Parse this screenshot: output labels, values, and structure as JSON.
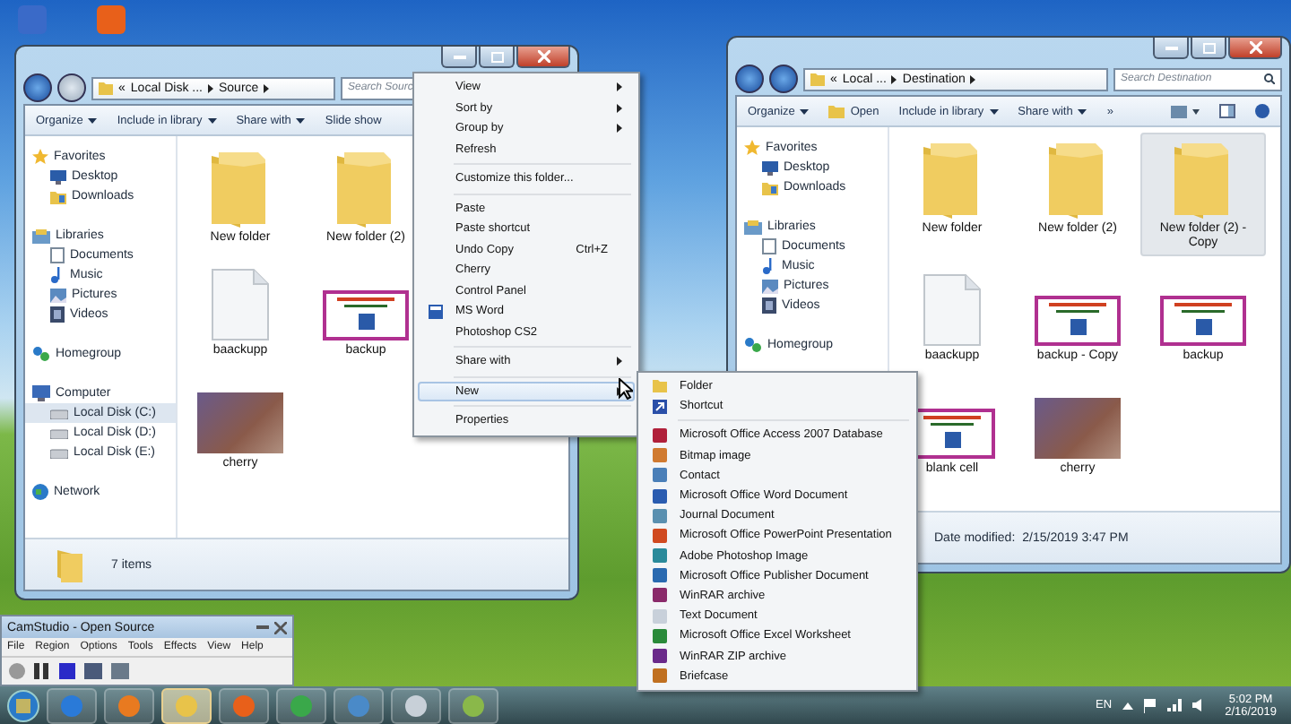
{
  "windows": [
    {
      "address": {
        "overflow": "«",
        "crumbs": [
          "Local Disk ...",
          "Source"
        ]
      },
      "search_placeholder": "Search Sourc",
      "toolbar": [
        {
          "label": "Organize",
          "menu": true
        },
        {
          "label": "Include in library",
          "menu": true
        },
        {
          "label": "Share with",
          "menu": true
        },
        {
          "label": "Slide show",
          "menu": false
        }
      ],
      "nav": [
        {
          "label": "Favorites",
          "kind": "star",
          "selected": false,
          "children": [
            {
              "label": "Desktop",
              "kind": "monitor",
              "selected": false
            },
            {
              "label": "Downloads",
              "kind": "folder",
              "selected": false
            }
          ]
        },
        {
          "label": "Libraries",
          "kind": "library",
          "selected": false,
          "children": [
            {
              "label": "Documents",
              "kind": "document",
              "selected": false
            },
            {
              "label": "Music",
              "kind": "note",
              "selected": false
            },
            {
              "label": "Pictures",
              "kind": "picture",
              "selected": false
            },
            {
              "label": "Videos",
              "kind": "film",
              "selected": false
            }
          ]
        },
        {
          "label": "Homegroup",
          "kind": "people",
          "selected": false
        },
        {
          "label": "Computer",
          "kind": "computer",
          "selected": false,
          "children": [
            {
              "label": "Local Disk (C:)",
              "kind": "drive",
              "selected": true
            },
            {
              "label": "Local Disk (D:)",
              "kind": "drive",
              "selected": false
            },
            {
              "label": "Local Disk (E:)",
              "kind": "drive",
              "selected": false
            }
          ]
        },
        {
          "label": "Network",
          "kind": "globe",
          "selected": false
        }
      ],
      "files": [
        {
          "name": "New folder",
          "kind": "folder",
          "selected": false
        },
        {
          "name": "New folder (2)",
          "kind": "folder",
          "selected": false
        },
        {
          "name": "baackupp",
          "kind": "blank",
          "selected": false
        },
        {
          "name": "backup",
          "kind": "slide",
          "selected": false
        },
        {
          "name": "cherry",
          "kind": "photo",
          "selected": false
        }
      ],
      "status": {
        "kind": "count",
        "text": "7 items"
      }
    },
    {
      "address": {
        "overflow": "«",
        "crumbs": [
          "Local ...",
          "Destination"
        ]
      },
      "search_placeholder": "Search Destination",
      "toolbar_icons": true,
      "toolbar": [
        {
          "label": "Organize",
          "menu": true
        },
        {
          "label": "Open",
          "menu": false,
          "icon": true
        },
        {
          "label": "Include in library",
          "menu": true
        },
        {
          "label": "Share with",
          "menu": true
        },
        {
          "label": "»",
          "menu": false
        }
      ],
      "nav": [
        {
          "label": "Favorites",
          "kind": "star",
          "selected": false,
          "children": [
            {
              "label": "Desktop",
              "kind": "monitor",
              "selected": false
            },
            {
              "label": "Downloads",
              "kind": "folder",
              "selected": false
            }
          ]
        },
        {
          "label": "Libraries",
          "kind": "library",
          "selected": false,
          "children": [
            {
              "label": "Documents",
              "kind": "document",
              "selected": false
            },
            {
              "label": "Music",
              "kind": "note",
              "selected": false
            },
            {
              "label": "Pictures",
              "kind": "picture",
              "selected": false
            },
            {
              "label": "Videos",
              "kind": "film",
              "selected": false
            }
          ]
        },
        {
          "label": "Homegroup",
          "kind": "people",
          "selected": false
        }
      ],
      "files": [
        {
          "name": "New folder",
          "kind": "folder",
          "selected": false
        },
        {
          "name": "New folder (2)",
          "kind": "folder",
          "selected": false
        },
        {
          "name": "New folder (2) - Copy",
          "kind": "folder",
          "selected": true
        },
        {
          "name": "baackupp",
          "kind": "blank",
          "selected": false
        },
        {
          "name": "backup - Copy",
          "kind": "slide",
          "selected": false
        },
        {
          "name": "backup",
          "kind": "slide",
          "selected": false
        },
        {
          "name": "blank cell",
          "kind": "slide",
          "selected": false
        },
        {
          "name": "cherry",
          "kind": "photo",
          "selected": false
        }
      ],
      "status": {
        "kind": "details",
        "label": "Date modified:",
        "text": "2/15/2019 3:47 PM"
      }
    }
  ],
  "context_menu": [
    {
      "kind": "item",
      "label": "View",
      "arrow": true,
      "selected": false
    },
    {
      "kind": "item",
      "label": "Sort by",
      "arrow": true,
      "selected": false
    },
    {
      "kind": "item",
      "label": "Group by",
      "arrow": true,
      "selected": false
    },
    {
      "kind": "item",
      "label": "Refresh",
      "arrow": false,
      "selected": false
    },
    {
      "kind": "separator"
    },
    {
      "kind": "item",
      "label": "Customize this folder...",
      "arrow": false,
      "selected": false
    },
    {
      "kind": "separator"
    },
    {
      "kind": "item",
      "label": "Paste",
      "arrow": false,
      "selected": false
    },
    {
      "kind": "item",
      "label": "Paste shortcut",
      "arrow": false,
      "selected": false
    },
    {
      "kind": "item",
      "label": "Undo Copy",
      "shortcut": "Ctrl+Z",
      "arrow": false,
      "selected": false
    },
    {
      "kind": "item",
      "label": "Cherry",
      "arrow": false,
      "selected": false
    },
    {
      "kind": "item",
      "label": "Control Panel",
      "arrow": false,
      "selected": false
    },
    {
      "kind": "app",
      "label": "MS Word",
      "arrow": false,
      "selected": false
    },
    {
      "kind": "item",
      "label": "Photoshop CS2",
      "arrow": false,
      "selected": false
    },
    {
      "kind": "separator"
    },
    {
      "kind": "item",
      "label": "Share with",
      "arrow": true,
      "selected": false
    },
    {
      "kind": "separator"
    },
    {
      "kind": "item",
      "label": "New",
      "arrow": true,
      "selected": true
    },
    {
      "kind": "separator"
    },
    {
      "kind": "item",
      "label": "Properties",
      "arrow": false,
      "selected": false
    }
  ],
  "new_submenu": [
    {
      "kind": "folder",
      "label": "Folder",
      "color": "#e8c34a",
      "selected": false
    },
    {
      "kind": "shortcut",
      "label": "Shortcut",
      "color": "#2a4fa8",
      "selected": false
    },
    {
      "kind": "separator"
    },
    {
      "kind": "file",
      "label": "Microsoft Office Access 2007 Database",
      "color": "#b0203a",
      "selected": false
    },
    {
      "kind": "file",
      "label": "Bitmap image",
      "color": "#d07a30",
      "selected": false
    },
    {
      "kind": "file",
      "label": "Contact",
      "color": "#4a7fb8",
      "selected": false
    },
    {
      "kind": "file",
      "label": "Microsoft Office Word Document",
      "color": "#2a5cb0",
      "selected": false
    },
    {
      "kind": "file",
      "label": "Journal Document",
      "color": "#5a90b0",
      "selected": false
    },
    {
      "kind": "file",
      "label": "Microsoft Office PowerPoint Presentation",
      "color": "#d04a20",
      "selected": false
    },
    {
      "kind": "file",
      "label": "Adobe Photoshop Image",
      "color": "#2a8a9a",
      "selected": false
    },
    {
      "kind": "file",
      "label": "Microsoft Office Publisher Document",
      "color": "#2a6ab0",
      "selected": false
    },
    {
      "kind": "file",
      "label": "WinRAR archive",
      "color": "#8a2a6a",
      "selected": false
    },
    {
      "kind": "file",
      "label": "Text Document",
      "color": "#c8d0da",
      "selected": false
    },
    {
      "kind": "file",
      "label": "Microsoft Office Excel Worksheet",
      "color": "#2a8a3a",
      "selected": false
    },
    {
      "kind": "file",
      "label": "WinRAR ZIP archive",
      "color": "#6a2a8a",
      "selected": false
    },
    {
      "kind": "file",
      "label": "Briefcase",
      "color": "#c07020",
      "selected": false
    }
  ],
  "camstudio": {
    "title": "CamStudio - Open Source",
    "menu": [
      "File",
      "Region",
      "Options",
      "Tools",
      "Effects",
      "View",
      "Help"
    ]
  },
  "taskbar": {
    "apps": [
      {
        "kind": "browser",
        "selected": false
      },
      {
        "kind": "player",
        "selected": false
      },
      {
        "kind": "explorer",
        "selected": true
      },
      {
        "kind": "fox",
        "selected": false
      },
      {
        "kind": "chrome",
        "selected": false
      },
      {
        "kind": "photo",
        "selected": false
      },
      {
        "kind": "video",
        "selected": false
      },
      {
        "kind": "paint",
        "selected": false
      }
    ],
    "language": "EN",
    "time": "5:02 PM",
    "date": "2/16/2019"
  }
}
